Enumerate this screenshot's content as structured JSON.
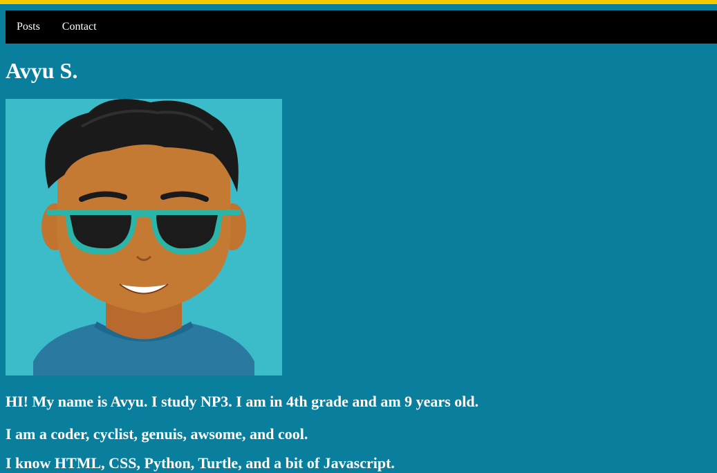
{
  "nav": {
    "items": [
      {
        "label": "Posts"
      },
      {
        "label": "Contact"
      }
    ]
  },
  "page": {
    "title": "Avyu S."
  },
  "bio": {
    "line1": "HI! My name is Avyu. I study NP3. I am in 4th grade and am 9 years old.",
    "line2": "I am a coder, cyclist, genuis, awsome, and cool.",
    "line3": "I know HTML, CSS, Python, Turtle, and a bit of Javascript."
  },
  "colors": {
    "background": "#0a7f9d",
    "top_stripe": "#f7c800",
    "navbar": "#000000",
    "avatar_bg": "#3bbcc8"
  }
}
